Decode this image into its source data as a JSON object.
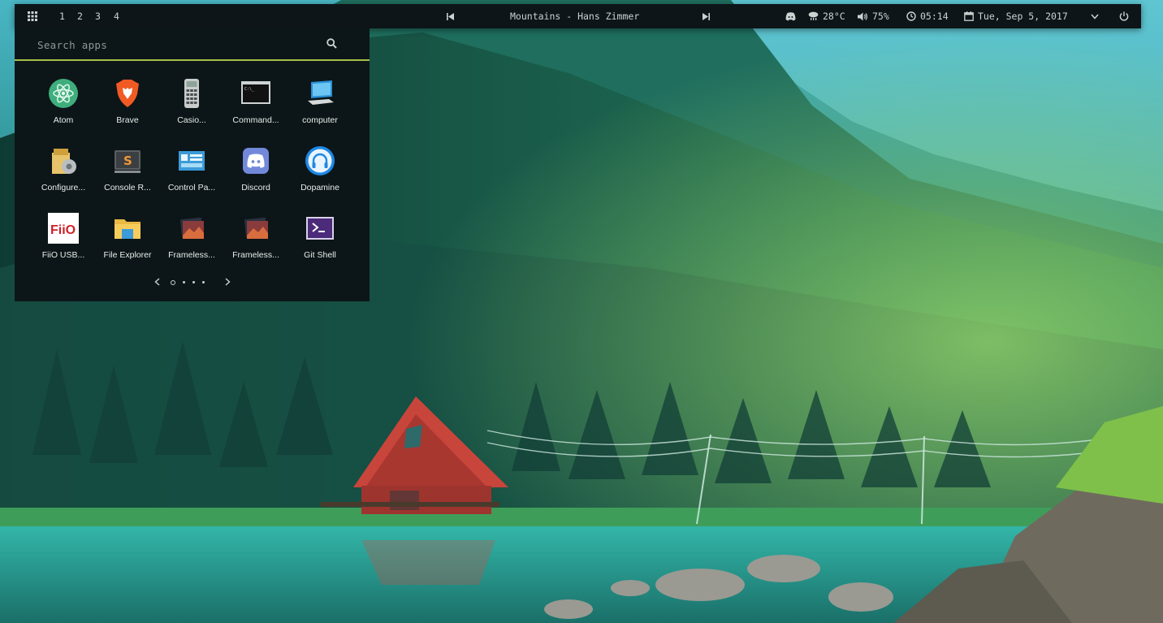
{
  "taskbar": {
    "workspaces": [
      "1",
      "2",
      "3",
      "4"
    ],
    "now_playing": "Mountains - Hans Zimmer",
    "weather": "28°C",
    "volume": "75%",
    "time": "05:14",
    "date": "Tue, Sep 5, 2017"
  },
  "launcher": {
    "search_placeholder": "Search apps",
    "apps": [
      {
        "label": "Atom",
        "icon": "atom-icon"
      },
      {
        "label": "Brave",
        "icon": "brave-icon"
      },
      {
        "label": "Casio...",
        "icon": "calculator-icon"
      },
      {
        "label": "Command...",
        "icon": "terminal-icon"
      },
      {
        "label": "computer",
        "icon": "computer-icon"
      },
      {
        "label": "Configure...",
        "icon": "configure-icon"
      },
      {
        "label": "Console R...",
        "icon": "sublime-icon"
      },
      {
        "label": "Control Pa...",
        "icon": "control-panel-icon"
      },
      {
        "label": "Discord",
        "icon": "discord-icon"
      },
      {
        "label": "Dopamine",
        "icon": "headphones-icon"
      },
      {
        "label": "FiiO USB...",
        "icon": "fiio-icon"
      },
      {
        "label": "File Explorer",
        "icon": "folder-icon"
      },
      {
        "label": "Frameless...",
        "icon": "image-viewer-icon"
      },
      {
        "label": "Frameless...",
        "icon": "image-viewer-icon"
      },
      {
        "label": "Git Shell",
        "icon": "powershell-icon"
      }
    ],
    "page_count": 4,
    "current_page": 1
  },
  "colors": {
    "bar_bg": "#0d1518",
    "accent_underline": "#a5bf4a",
    "text": "#c9d4d2"
  }
}
